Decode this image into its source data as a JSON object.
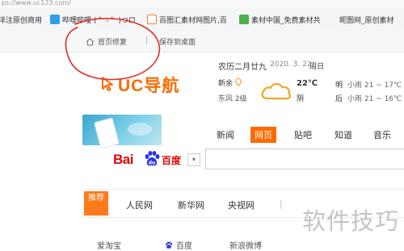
{
  "browser": {
    "url_fragment": "ps://www.uc123.com/",
    "bookmarks": [
      {
        "label": "洋注原创商用"
      },
      {
        "label": "哔哩哔哩 ( ゜- ゜)つロ"
      },
      {
        "label": "百图汇素材网图片,百"
      },
      {
        "label": "素材中国_免费素材共"
      },
      {
        "label": "昵图网_原创素材"
      }
    ],
    "subbar": {
      "home_fix_label": "首页修复",
      "divider": "|",
      "save_desktop_label": "保存到桌面"
    }
  },
  "uc": {
    "logo_text": "UC导航"
  },
  "calendar": {
    "lunar": "农历二月廿九",
    "date": "2020. 3. 22",
    "weekday": "周日"
  },
  "weather": {
    "city": "新余",
    "district": "东风 2级",
    "temp_now": "22℃",
    "condition_now": "阴",
    "tomorrow_label": "明",
    "tomorrow": "小雨  21 ~ 17℃",
    "after_label": "后",
    "after": "小雨  21 ~ 16℃"
  },
  "search": {
    "tabs": [
      "新闻",
      "网页",
      "贴吧",
      "知道",
      "音乐"
    ],
    "active_tab": "网页",
    "engine": "百度",
    "engine_logo": "Bai百度"
  },
  "nav": {
    "tuijian_label": "推荐",
    "links": [
      "人民网",
      "新华网",
      "央视网",
      "|"
    ]
  },
  "bottom": {
    "links": [
      "爱淘宝",
      "百度",
      "新浪微博"
    ]
  },
  "watermark": "软件技巧",
  "colors": {
    "accent": "#ff6a00",
    "baidu_red": "#e10602",
    "baidu_blue": "#2932e1",
    "annotation_red": "#e52b2b"
  }
}
